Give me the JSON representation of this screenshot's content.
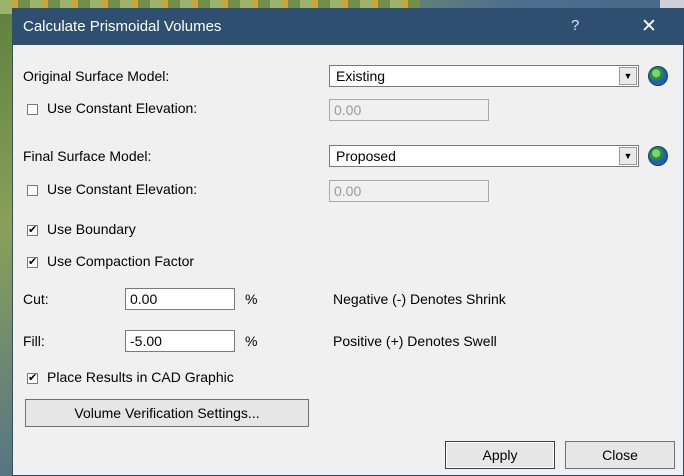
{
  "window": {
    "title": "Calculate Prismoidal Volumes",
    "help": "?",
    "close_glyph": "✕"
  },
  "original": {
    "label": "Original Surface Model:",
    "selected": "Existing",
    "use_constant_label": "Use Constant Elevation:",
    "use_constant_checked": false,
    "elevation_value": "0.00"
  },
  "final": {
    "label": "Final Surface Model:",
    "selected": "Proposed",
    "use_constant_label": "Use Constant Elevation:",
    "use_constant_checked": false,
    "elevation_value": "0.00"
  },
  "options": {
    "use_boundary_label": "Use Boundary",
    "use_boundary_checked": true,
    "use_compaction_label": "Use Compaction Factor",
    "use_compaction_checked": true
  },
  "compaction": {
    "cut_label": "Cut:",
    "cut_value": "0.00",
    "fill_label": "Fill:",
    "fill_value": "-5.00",
    "unit": "%",
    "negative_note": "Negative (-) Denotes Shrink",
    "positive_note": "Positive (+) Denotes Swell"
  },
  "place_results": {
    "label": "Place Results in CAD Graphic",
    "checked": true
  },
  "buttons": {
    "verification": "Volume Verification Settings...",
    "apply": "Apply",
    "close": "Close"
  },
  "checkmark": "✔",
  "colors": {
    "titlebar": "#2e4f70",
    "dialog_bg": "#f0f0f0"
  }
}
